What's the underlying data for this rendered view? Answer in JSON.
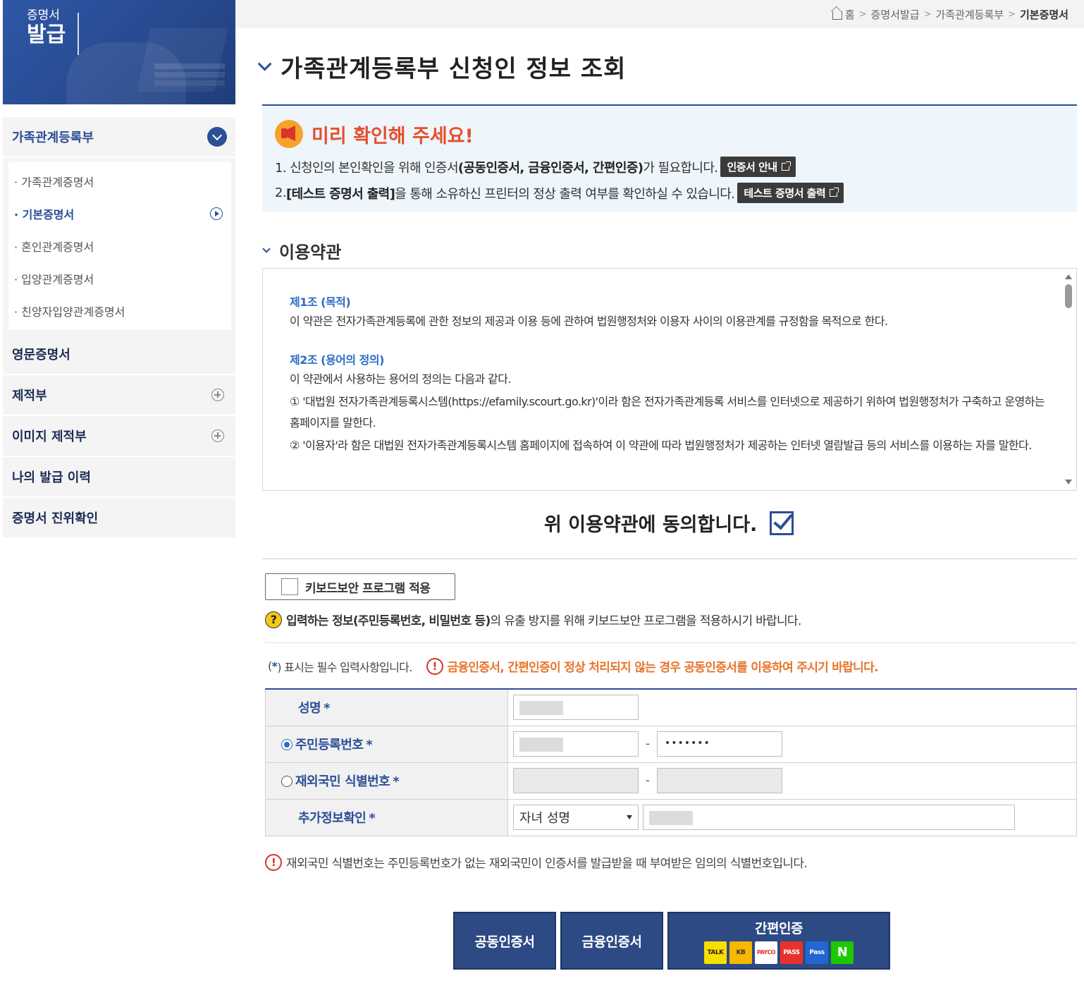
{
  "sidebar": {
    "banner": {
      "line1": "증명서",
      "line2": "발급"
    },
    "menu": {
      "family_register": "가족관계등록부",
      "sub_items": [
        {
          "label": "· 가족관계증명서"
        },
        {
          "label": "· 기본증명서"
        },
        {
          "label": "· 혼인관계증명서"
        },
        {
          "label": "· 입양관계증명서"
        },
        {
          "label": "· 친양자입양관계증명서"
        }
      ],
      "english_cert": "영문증명서",
      "jejeokbu": "제적부",
      "image_jejeokbu": "이미지 제적부",
      "my_history": "나의 발급 이력",
      "verify": "증명서 진위확인"
    }
  },
  "breadcrumb": {
    "home": "홈",
    "sep": ">",
    "item1": "증명서발급",
    "item2": "가족관계등록부",
    "current": "기본증명서"
  },
  "page_title": "가족관계등록부 신청인 정보 조회",
  "notice": {
    "title": "미리 확인해 주세요!",
    "line1_a": "1. 신청인의 본인확인을 위해 인증서",
    "line1_b": "(공동인증서, 금융인증서, 간편인증)",
    "line1_c": "가 필요합니다.",
    "cert_guide_btn": "인증서 안내",
    "line2_a": "2. ",
    "line2_b": "[테스트 증명서 출력]",
    "line2_c": "을 통해 소유하신 프린터의 정상 출력 여부를 확인하실 수 있습니다.",
    "test_print_btn": "테스트 증명서 출력"
  },
  "terms": {
    "section_title": "이용약관",
    "art1_title": "제1조 (목적)",
    "art1_body": "이 약관은 전자가족관계등록에 관한 정보의 제공과 이용 등에 관하여 법원행정처와 이용자 사이의 이용관계를 규정함을 목적으로 한다.",
    "art2_title": "제2조 (용어의 정의)",
    "art2_body1": "이 약관에서 사용하는 용어의 정의는 다음과 같다.",
    "art2_body2": "① '대법원 전자가족관계등록시스템(https://efamily.scourt.go.kr)'이라 함은 전자가족관계등록 서비스를 인터넷으로 제공하기 위하여 법원행정처가 구축하고 운영하는 홈페이지를 말한다.",
    "art2_body3": "② '이용자'라 함은 대법원 전자가족관계등록시스템 홈페이지에 접속하여 이 약관에 따라 법원행정처가 제공하는 인터넷 열람발급 등의 서비스를 이용하는 자를 말한다."
  },
  "agree_text": "위 이용약관에 동의합니다.",
  "keyboard_security": "키보드보안 프로그램 적용",
  "keyboard_help_a": "입력하는 정보(주민등록번호, 비밀번호 등)",
  "keyboard_help_b": "의 유출 방지를 위해 키보드보안 프로그램을 적용하시기 바랍니다.",
  "required_note": {
    "open": "(",
    "star": "*",
    "rest": ") 표시는 필수 입력사항입니다.",
    "warning": "금융인증서, 간편인증이 정상 처리되지 않는 경우 공동인증서를 이용하여 주시기 바랍니다."
  },
  "form": {
    "name_label": "성명",
    "rrn_label": "주민등록번호",
    "rrn_back_value": "•••••••",
    "foreign_label": "재외국민 식별번호",
    "extra_label": "추가정보확인",
    "extra_select": "자녀 성명",
    "star": "*",
    "dash": "-"
  },
  "foreign_note": "재외국민 식별번호는 주민등록번호가 없는 재외국민이 인증서를 발급받을 때 부여받은 임의의 식별번호입니다.",
  "buttons": {
    "joint_cert": "공동인증서",
    "financial_cert": "금융인증서",
    "simple_auth": "간편인증",
    "logos": [
      "TALK",
      "KB",
      "PAYCO",
      "PASS",
      "Pass",
      "N"
    ]
  },
  "colors": {
    "brand": "#2b4e96",
    "notice_title": "#e4502e",
    "warning": "#e8742b",
    "link": "#2b6cc4",
    "button": "#2d4a84"
  }
}
